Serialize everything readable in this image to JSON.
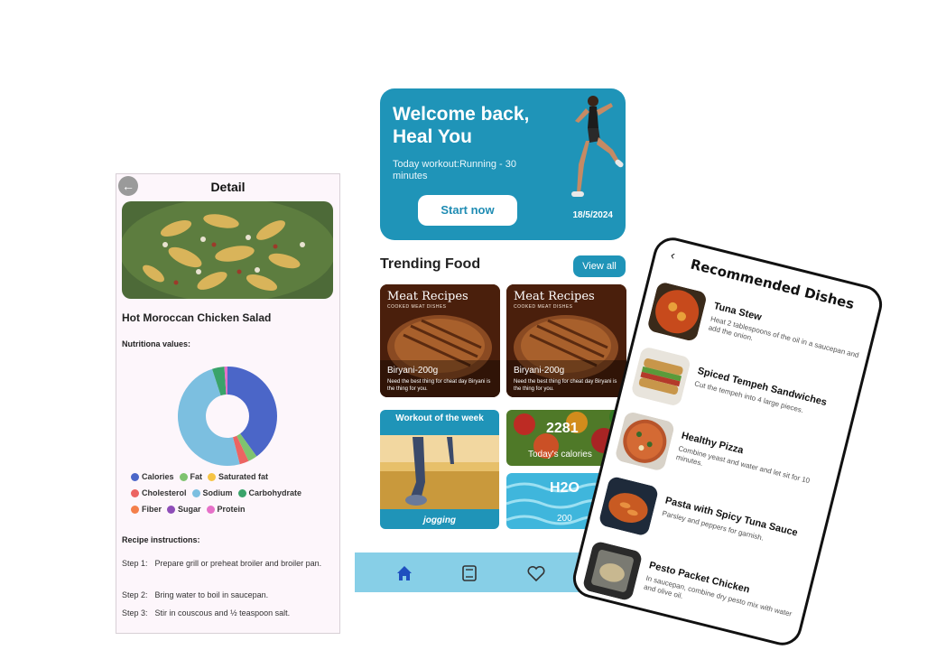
{
  "detail": {
    "title": "Detail",
    "dish_name": "Hot Moroccan Chicken Salad",
    "nutrition_label": "Nutritiona values:",
    "chart_data": {
      "type": "pie",
      "categories": [
        "Calories",
        "Fat",
        "Saturated fat",
        "Cholesterol",
        "Sodium",
        "Carbohydrate",
        "Fiber",
        "Sugar",
        "Protein"
      ],
      "values": [
        40,
        3,
        0,
        3,
        49,
        4,
        0,
        0,
        1
      ],
      "colors": [
        "#4b66c8",
        "#7fc36f",
        "#f6c445",
        "#ec6462",
        "#7cbfe0",
        "#3aa36a",
        "#f47f4a",
        "#8e4db8",
        "#e670c8"
      ]
    },
    "legend": [
      {
        "label": "Calories",
        "color": "#4b66c8"
      },
      {
        "label": "Fat",
        "color": "#7fc36f"
      },
      {
        "label": "Saturated fat",
        "color": "#f6c445"
      },
      {
        "label": "Cholesterol",
        "color": "#ec6462"
      },
      {
        "label": "Sodium",
        "color": "#7cbfe0"
      },
      {
        "label": "Carbohydrate",
        "color": "#3aa36a"
      },
      {
        "label": "Fiber",
        "color": "#f47f4a"
      },
      {
        "label": "Sugar",
        "color": "#8e4db8"
      },
      {
        "label": "Protein",
        "color": "#e670c8"
      }
    ],
    "instructions_label": "Recipe instructions:",
    "steps": [
      {
        "num": "Step 1:",
        "text": "Prepare grill or preheat broiler and broiler pan."
      },
      {
        "num": "Step 2:",
        "text": "Bring water to boil in saucepan."
      },
      {
        "num": "Step 3:",
        "text": "Stir in couscous and ½ teaspoon salt."
      }
    ]
  },
  "home": {
    "welcome_title": "Welcome back, Heal You",
    "workout_text": "Today workout:Running - 30 minutes",
    "start_label": "Start now",
    "date": "18/5/2024",
    "trending_title": "Trending Food",
    "view_all_label": "View all",
    "food_cards": [
      {
        "header": "Meat Recipes",
        "sub": "COOKED MEAT DISHES",
        "name": "Biryani-200g",
        "desc": "Need the best thing for cheat day Biryani is the thing for you."
      },
      {
        "header": "Meat Recipes",
        "sub": "COOKED MEAT DISHES",
        "name": "Biryani-200g",
        "desc": "Need the best thing for cheat day Biryani is the thing for you."
      }
    ],
    "workout_week_title": "Workout of the week",
    "workout_week_name": "jogging",
    "calories_value": "2281",
    "calories_label": "Today's calories",
    "water_label": "H2O",
    "water_value": "200"
  },
  "recommended": {
    "title": "Recommended Dishes",
    "items": [
      {
        "name": "Tuna Stew",
        "desc": "Heat 2 tablespoons of the oil in a saucepan and add the onion."
      },
      {
        "name": "Spiced Tempeh Sandwiches",
        "desc": "Cut the tempeh into 4 large pieces."
      },
      {
        "name": "Healthy Pizza",
        "desc": "Combine yeast and water and let sit for 10 minutes."
      },
      {
        "name": "Pasta with Spicy Tuna Sauce",
        "desc": "Parsley and peppers for garnish."
      },
      {
        "name": "Pesto Packet Chicken",
        "desc": "In saucepan, combine dry pesto mix with water and olive oil."
      }
    ]
  }
}
